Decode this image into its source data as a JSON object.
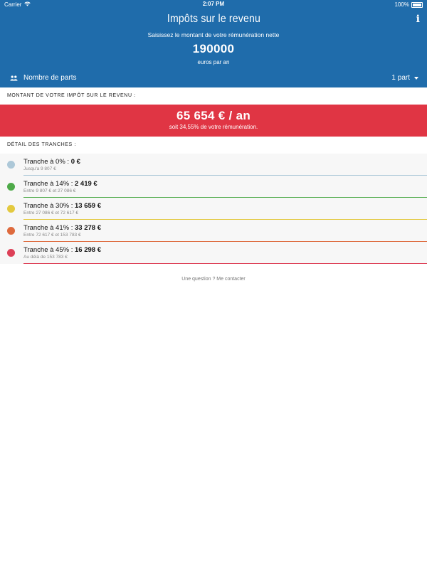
{
  "status_bar": {
    "carrier": "Carrier",
    "time": "2:07 PM",
    "battery": "100%"
  },
  "header": {
    "title": "Impôts sur le revenu",
    "info_label": "i",
    "prompt": "Saisissez le montant de votre rémunération nette",
    "amount": "190000",
    "unit": "euros par an",
    "parts_label": "Nombre de parts",
    "parts_value": "1 part"
  },
  "tax": {
    "section_label": "Montant de votre impôt sur le revenu :",
    "amount": "65 654 € / an",
    "percentage": "soit 34,55% de votre rémunération."
  },
  "brackets": {
    "section_label": "Détail des tranches :",
    "items": [
      {
        "label": "Tranche à 0% : ",
        "value": "0 €",
        "range": "Jusqu'a 9 807 €",
        "color": "#adc8d8"
      },
      {
        "label": "Tranche à 14% : ",
        "value": "2 419 €",
        "range": "Entre 9 807 € et 27 086 €",
        "color": "#4eaa49"
      },
      {
        "label": "Tranche à 30% : ",
        "value": "13 659 €",
        "range": "Entre 27 086 € et 72 617 €",
        "color": "#e3c93f"
      },
      {
        "label": "Tranche à 41% : ",
        "value": "33 278 €",
        "range": "Entre 72 617 € et 153 783 €",
        "color": "#de6a3d"
      },
      {
        "label": "Tranche à 45% : ",
        "value": "16 298 €",
        "range": "Au délà de 153 783 €",
        "color": "#dd4057"
      }
    ]
  },
  "footer": {
    "contact": "Une question ? Me contacter"
  },
  "colors": {
    "header_bg": "#1f6cab",
    "tax_bg": "#e03544"
  }
}
